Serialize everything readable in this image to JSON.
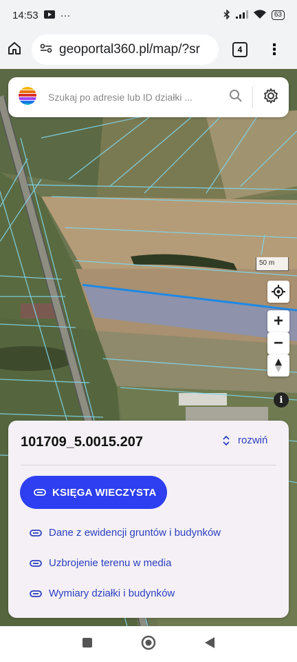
{
  "status_bar": {
    "time": "14:53",
    "dots": "···",
    "battery": "63"
  },
  "browser": {
    "url": "geoportal360.pl/map/?sr",
    "tab_count": "4"
  },
  "search": {
    "placeholder": "Szukaj po adresie lub ID działki ..."
  },
  "map": {
    "scale_label": "50 m",
    "zoom_in": "+",
    "zoom_out": "−",
    "info": "i"
  },
  "panel": {
    "parcel_id": "101709_5.0015.207",
    "expand_label": "rozwiń",
    "kw_button": "KSIĘGA WIECZYSTA",
    "links": [
      "Dane z ewidencji gruntów i budynków",
      "Uzbrojenie terenu w media",
      "Wymiary działki i budynków"
    ]
  },
  "colors": {
    "accent": "#2D3FF0",
    "link": "#2B3FBF",
    "parcel_outline": "#1E88E5"
  }
}
